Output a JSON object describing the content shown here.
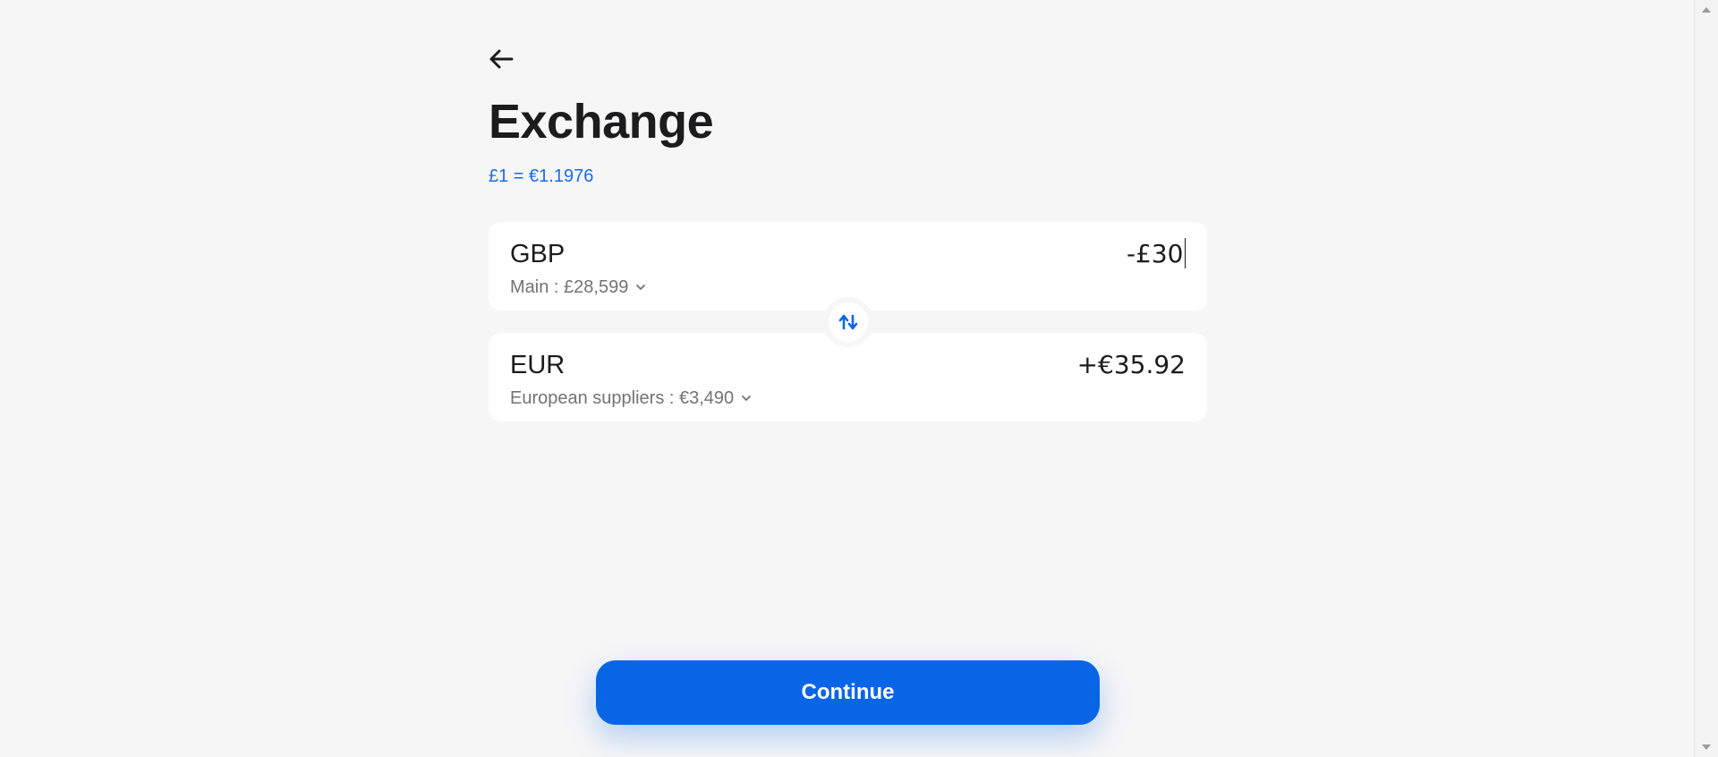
{
  "header": {
    "back_icon": "arrow-left-icon",
    "title": "Exchange",
    "rate": "£1 = €1.1976"
  },
  "from": {
    "currency": "GBP",
    "account": "Main : £28,599",
    "amount": "-£30"
  },
  "to": {
    "currency": "EUR",
    "account": "European suppliers : €3,490",
    "amount": "+€35.92"
  },
  "swap": {
    "icon": "swap-vertical-icon"
  },
  "actions": {
    "continue_label": "Continue"
  },
  "colors": {
    "accent": "#0866e6",
    "rate_text": "#1a6be8",
    "background": "#f6f6f7",
    "card": "#ffffff",
    "muted_text": "#717378"
  }
}
